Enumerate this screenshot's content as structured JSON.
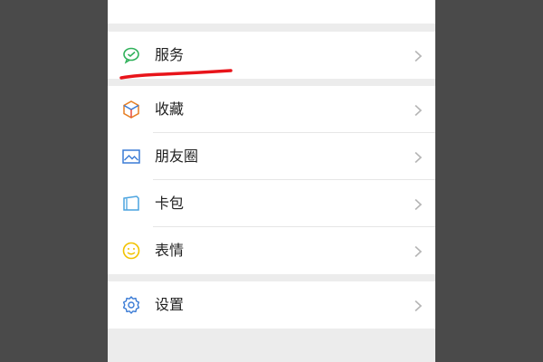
{
  "menu": {
    "services": {
      "label": "服务",
      "icon": "wechat-pay-icon"
    },
    "items": [
      {
        "label": "收藏",
        "icon": "favorites-cube-icon"
      },
      {
        "label": "朋友圈",
        "icon": "moments-picture-icon"
      },
      {
        "label": "卡包",
        "icon": "card-wallet-icon"
      },
      {
        "label": "表情",
        "icon": "emoji-smile-icon"
      }
    ],
    "settings": {
      "label": "设置",
      "icon": "gear-icon"
    }
  },
  "colors": {
    "annotation": "#e8141a",
    "services_icon": "#2fb15a",
    "favorites_icon": "#e67e22",
    "moments_icon": "#3a7bd5",
    "card_icon": "#4aa3df",
    "emoji_icon": "#f2c200",
    "settings_icon": "#3a7bd5"
  }
}
